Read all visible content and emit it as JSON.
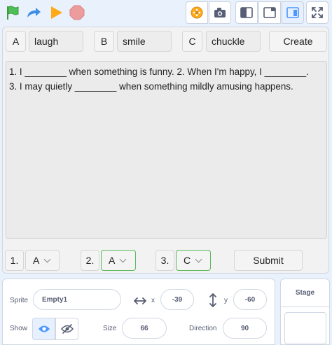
{
  "colors": {
    "accent": "#4c97ff",
    "green_flag": "#4cbf56",
    "stop": "#ec9c9c",
    "select_border": "#5cb85c"
  },
  "toolbar": {
    "icons": [
      "green-flag-icon",
      "turbo-arrow-icon",
      "play-icon",
      "stop-icon",
      "extension-icon",
      "camera-icon",
      "small-stage-icon",
      "medium-stage-icon",
      "large-stage-icon",
      "fullscreen-icon"
    ]
  },
  "game": {
    "options": [
      {
        "letter": "A",
        "word": "laugh"
      },
      {
        "letter": "B",
        "word": "smile"
      },
      {
        "letter": "C",
        "word": "chuckle"
      }
    ],
    "create_label": "Create",
    "sentences_line1": "1. I ________ when something is funny.  2. When I'm happy, I ________.",
    "sentences_line2": "3. I may quietly ________ when something mildly amusing happens.",
    "answers": [
      {
        "num": "1.",
        "value": "A"
      },
      {
        "num": "2.",
        "value": "A"
      },
      {
        "num": "3.",
        "value": "C"
      }
    ],
    "submit_label": "Submit"
  },
  "sprite_info": {
    "sprite_label": "Sprite",
    "sprite_name": "Empty1",
    "x_label": "x",
    "x_value": "-39",
    "y_label": "y",
    "y_value": "-60",
    "show_label": "Show",
    "size_label": "Size",
    "size_value": "66",
    "direction_label": "Direction",
    "direction_value": "90"
  },
  "stage_panel": {
    "title": "Stage"
  }
}
